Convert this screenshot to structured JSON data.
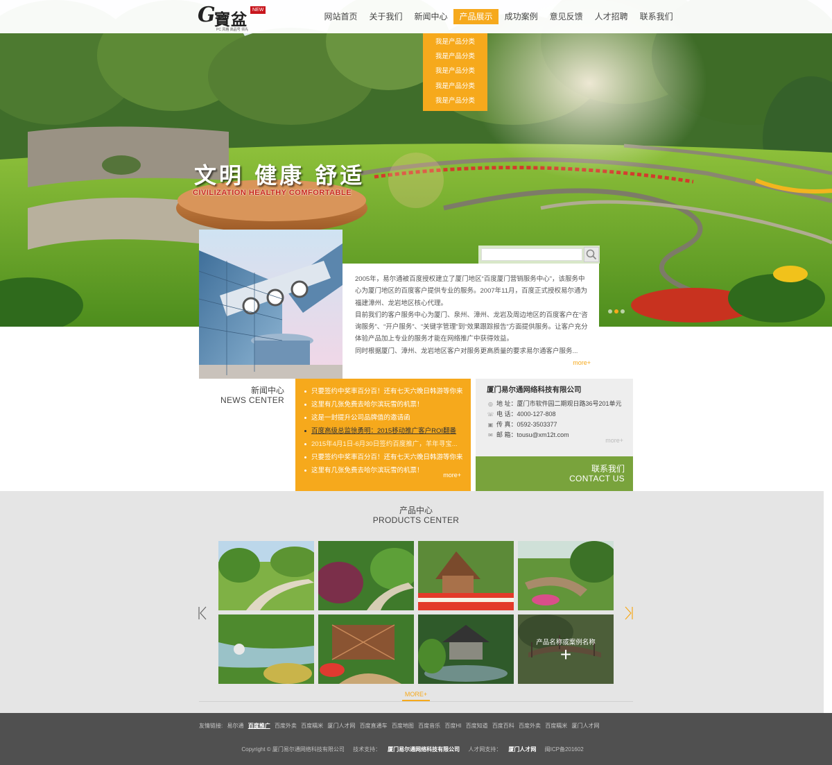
{
  "brand": {
    "logo_letter": "G",
    "logo_text": "寶盆",
    "badge": "NEW",
    "tagline": "PC 风格 高品号 领先"
  },
  "nav": {
    "items": [
      "网站首页",
      "关于我们",
      "新闻中心",
      "产品展示",
      "成功案例",
      "意见反馈",
      "人才招聘",
      "联系我们"
    ],
    "active": "产品展示"
  },
  "dropdown": {
    "items": [
      "我是产品分类",
      "我是产品分类",
      "我是产品分类",
      "我是产品分类",
      "我是产品分类"
    ]
  },
  "banner": {
    "slogan_cn": "文明 健康 舒适",
    "slogan_en": "CIVILIZATION HEALTHY COMFORTABLE",
    "slide_count": 3,
    "active_slide": 2
  },
  "search": {
    "placeholder": "",
    "icon": "search-icon"
  },
  "about": {
    "paragraphs": [
      "2005年，易尔通被百度授权建立了厦门地区“百度厦门营销服务中心”，该服务中心为厦门地区的百度客户提供专业的服务。2007年11月，百度正式授权易尔通为福建漳州、龙岩地区核心代理。",
      "目前我们的客户服务中心为厦门、泉州、漳州、龙岩及周边地区的百度客户在“咨询服务”、“开户服务”、“关键字管理”到“效果跟踪报告”方面提供服务。让客户充分体验产品加上专业的服务才能在网络推广中获得效益。",
      "同时根据厦门、漳州、龙岩地区客户对服务更高质量的要求易尔通客户服务..."
    ],
    "more": "more+"
  },
  "news": {
    "title_cn": "新闻中心",
    "title_en": "NEWS CENTER",
    "items": [
      "只要签约中奖率百分百！还有七天六晚日韩游等你来！",
      "这里有几张免费去哈尔滨玩雪的机票！",
      "这是一封提升公司品牌值的邀请函",
      "百度高级总监徐勇明：2015移动推广客户ROI翻番",
      "2015年4月1日-6月30日签约百度推广，羊年寻宝...",
      "只要签约中奖率百分百！还有七天六晚日韩游等你来！",
      "这里有几张免费去哈尔滨玩雪的机票！"
    ],
    "more": "more+"
  },
  "contact": {
    "company": "厦门易尔通网络科技有限公司",
    "address": "地 址：厦门市软件园二期观日路36号201单元",
    "phone": "电 话：4000-127-808",
    "fax": "传 真：0592-3503377",
    "email": "邮 箱：tousu@xm12t.com",
    "more": "more+",
    "title_cn": "联系我们",
    "title_en": "CONTACT US"
  },
  "products": {
    "title_cn": "产品中心",
    "title_en": "PRODUCTS CENTER",
    "hover_caption": "产品名称或案例名称",
    "hover_plus": "+",
    "more": "MORE+"
  },
  "footer": {
    "links_label": "友情链接:",
    "links": [
      "易尔通",
      "百度推广",
      "百度外卖",
      "百度糯米",
      "厦门人才网",
      "百度直通车",
      "百度地图",
      "百度音乐",
      "百度HI",
      "百度知道",
      "百度百科",
      "百度外卖",
      "百度糯米",
      "厦门人才网"
    ],
    "copyright": "Copyright © 厦门易尔通网络科技有限公司",
    "support_label": "技术支持：",
    "support": "厦门易尔通网络科技有限公司",
    "talent_label": "人才网支持：",
    "talent": "厦门人才网",
    "icp": "闽ICP备201602"
  },
  "colors": {
    "accent": "#f6a91c",
    "contact_green": "#79a33c",
    "footer": "#505050",
    "section_gray": "#e5e5e5"
  }
}
